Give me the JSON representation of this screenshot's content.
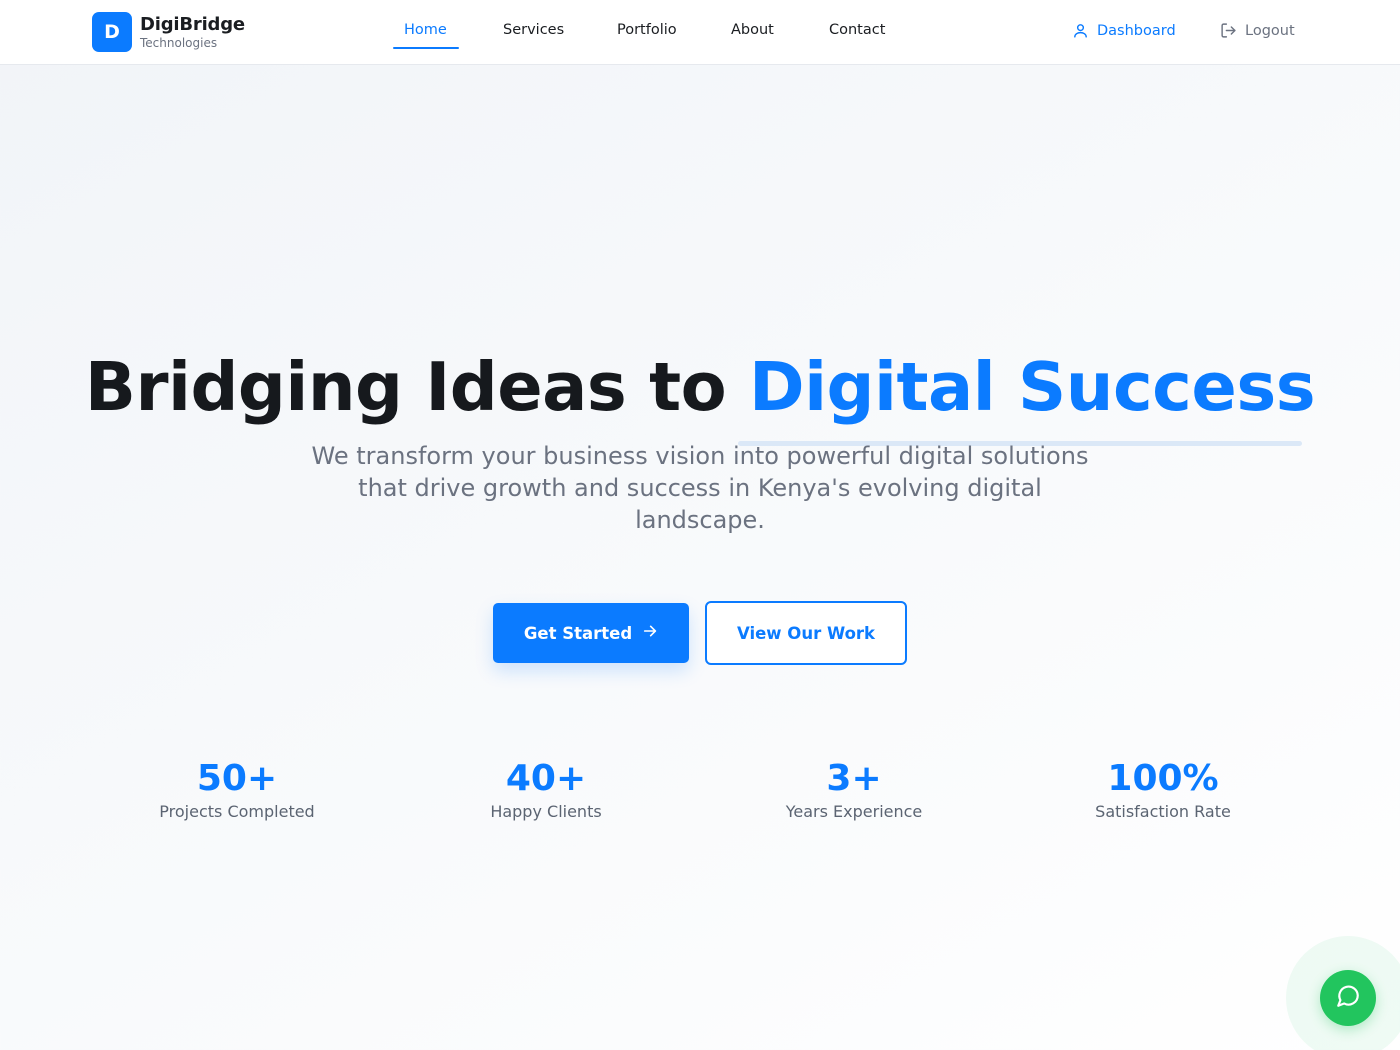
{
  "brand": {
    "logo_letter": "D",
    "name": "DigiBridge",
    "tagline": "Technologies"
  },
  "nav": {
    "items": [
      {
        "label": "Home",
        "active": true
      },
      {
        "label": "Services",
        "active": false
      },
      {
        "label": "Portfolio",
        "active": false
      },
      {
        "label": "About",
        "active": false
      },
      {
        "label": "Contact",
        "active": false
      }
    ]
  },
  "header_actions": {
    "dashboard": {
      "label": "Dashboard",
      "icon": "user-icon"
    },
    "logout": {
      "label": "Logout",
      "icon": "logout-icon"
    }
  },
  "hero": {
    "title_main": "Bridging Ideas to ",
    "title_accent": "Digital Success",
    "subtitle": "We transform your business vision into powerful digital solutions that drive growth and success in Kenya's evolving digital landscape.",
    "primary_cta": {
      "label": "Get Started",
      "icon": "arrow-right-icon"
    },
    "secondary_cta": {
      "label": "View Our Work"
    }
  },
  "stats": [
    {
      "value": "50+",
      "label": "Projects Completed"
    },
    {
      "value": "40+",
      "label": "Happy Clients"
    },
    {
      "value": "3+",
      "label": "Years Experience"
    },
    {
      "value": "100%",
      "label": "Satisfaction Rate"
    }
  ],
  "chat": {
    "icon": "chat-bubble-icon"
  },
  "colors": {
    "accent": "#0b7bff",
    "text": "#16191d",
    "muted": "#6b7280",
    "chat": "#22c55e"
  }
}
